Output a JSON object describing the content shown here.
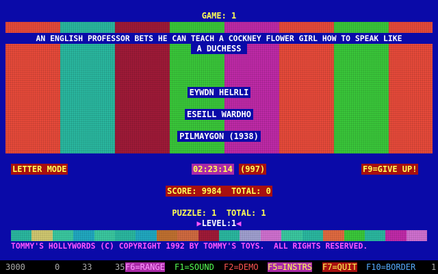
{
  "header": {
    "game_label": "GAME: 1"
  },
  "clue": {
    "line1": "AN ENGLISH PROFESSOR BETS HE CAN TEACH A COCKNEY FLOWER GIRL HOW TO SPEAK LIKE",
    "line2": "A DUCHESS"
  },
  "scrambled": {
    "word1": "EYWDN HELRLI",
    "word2": "ESEILL WARDHO",
    "word3": "PILMAYGON (1938)"
  },
  "mode": {
    "letter_mode": "LETTER MODE",
    "give_up": "F9=GIVE UP!"
  },
  "timer": {
    "time": "02:23:14",
    "count": "(997)"
  },
  "score": {
    "text": "SCORE: 9984  TOTAL: 0"
  },
  "puzzle": {
    "text": "PUZZLE: 1  TOTAL: 1"
  },
  "level": {
    "left_arrow": "▶",
    "text": "LEVEL:1",
    "right_arrow": "◀"
  },
  "copyright": "TOMMY'S HOLLYWORDS (C) COPYRIGHT 1992 BY TOMMY'S TOYS.  ALL RIGHTS RESERVED.",
  "palette_colors": [
    "#2ab8a0",
    "#d0c870",
    "#3ac8a0",
    "#20a8c0",
    "#3ac8a0",
    "#2ab8a0",
    "#20a8c0",
    "#c07030",
    "#d06a40",
    "#a01a38",
    "#2ab8a0",
    "#a0a0d0",
    "#d070d0",
    "#3ac8a0",
    "#2ab8a0",
    "#e06a40",
    "#3ac83a",
    "#2ab8a0",
    "#c02aa8",
    "#d070d0"
  ],
  "status": {
    "n1": "3000",
    "n2": "0",
    "n3": "33",
    "n4": "35",
    "f6": "F6=RANGE",
    "f1": "F1=SOUND",
    "f2": "F2=DEMO",
    "f5": "F5=INSTRS",
    "f7": "F7=QUIT",
    "f10": "F10=BORDER",
    "n5": "1"
  }
}
